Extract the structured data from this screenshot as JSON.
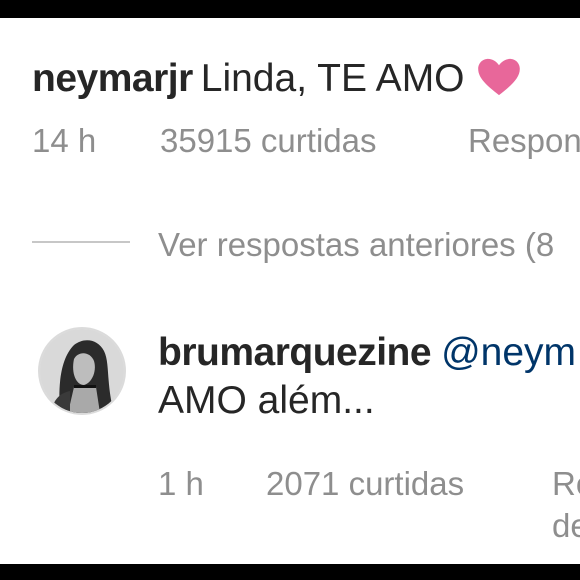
{
  "comment": {
    "username": "neymarjr",
    "text": "Linda, TE AMO",
    "time": "14 h",
    "likes": "35915 curtidas",
    "reply_label": "Respon"
  },
  "view_replies": "Ver respostas anteriores (8",
  "reply": {
    "username": "brumarquezine",
    "mention": "@neym",
    "text": "AMO além...",
    "time": "1 h",
    "likes": "2071 curtidas",
    "reply_label_line1": "Re",
    "reply_label_line2": "de"
  },
  "colors": {
    "username": "#262626",
    "meta": "#8e8e8e",
    "mention": "#003569",
    "heart": "#e8679a"
  }
}
